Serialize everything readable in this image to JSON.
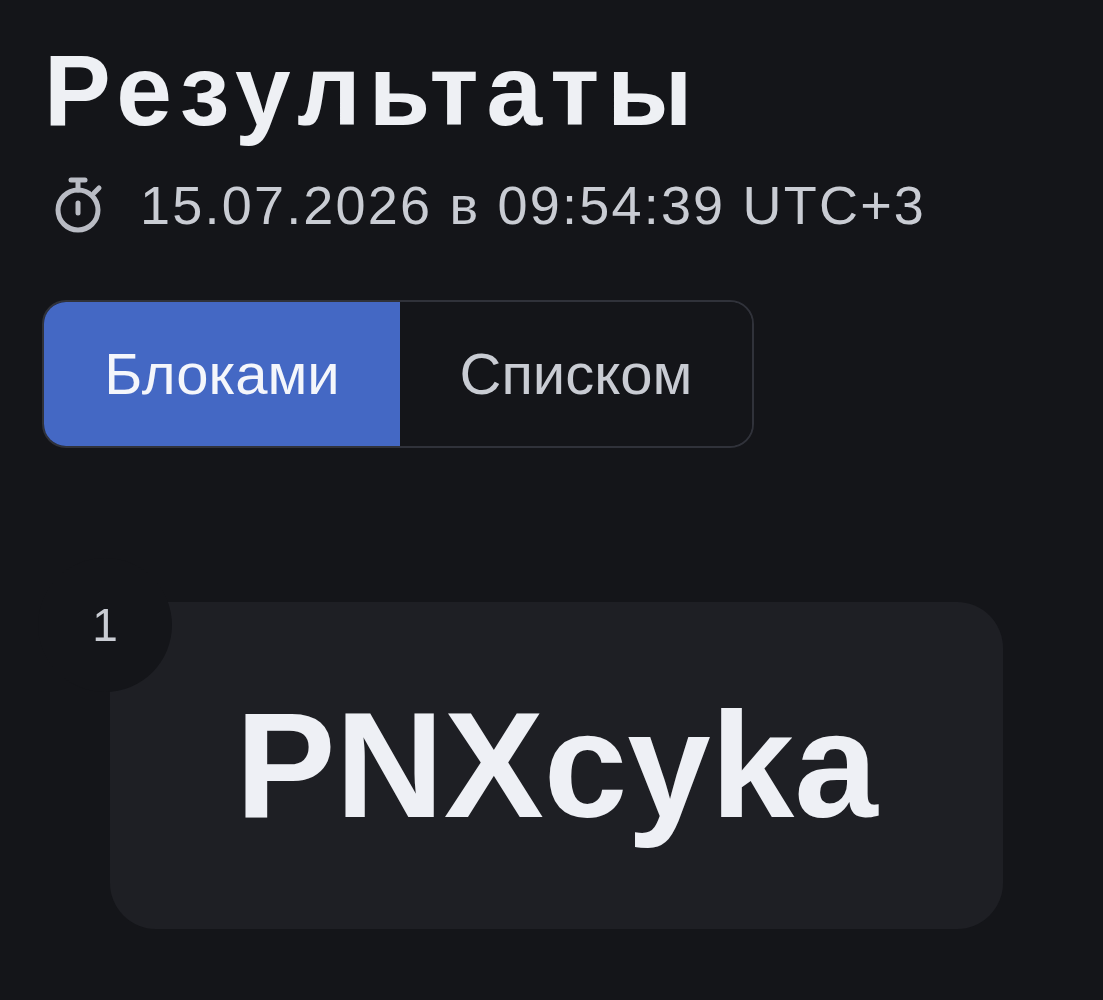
{
  "page": {
    "title": "Результаты",
    "timestamp": "15.07.2026 в 09:54:39 UTC+3"
  },
  "view_toggle": [
    {
      "label": "Блоками",
      "selected": true
    },
    {
      "label": "Списком",
      "selected": false
    }
  ],
  "results": [
    {
      "number": "1",
      "text": "PNXcyka"
    }
  ]
}
